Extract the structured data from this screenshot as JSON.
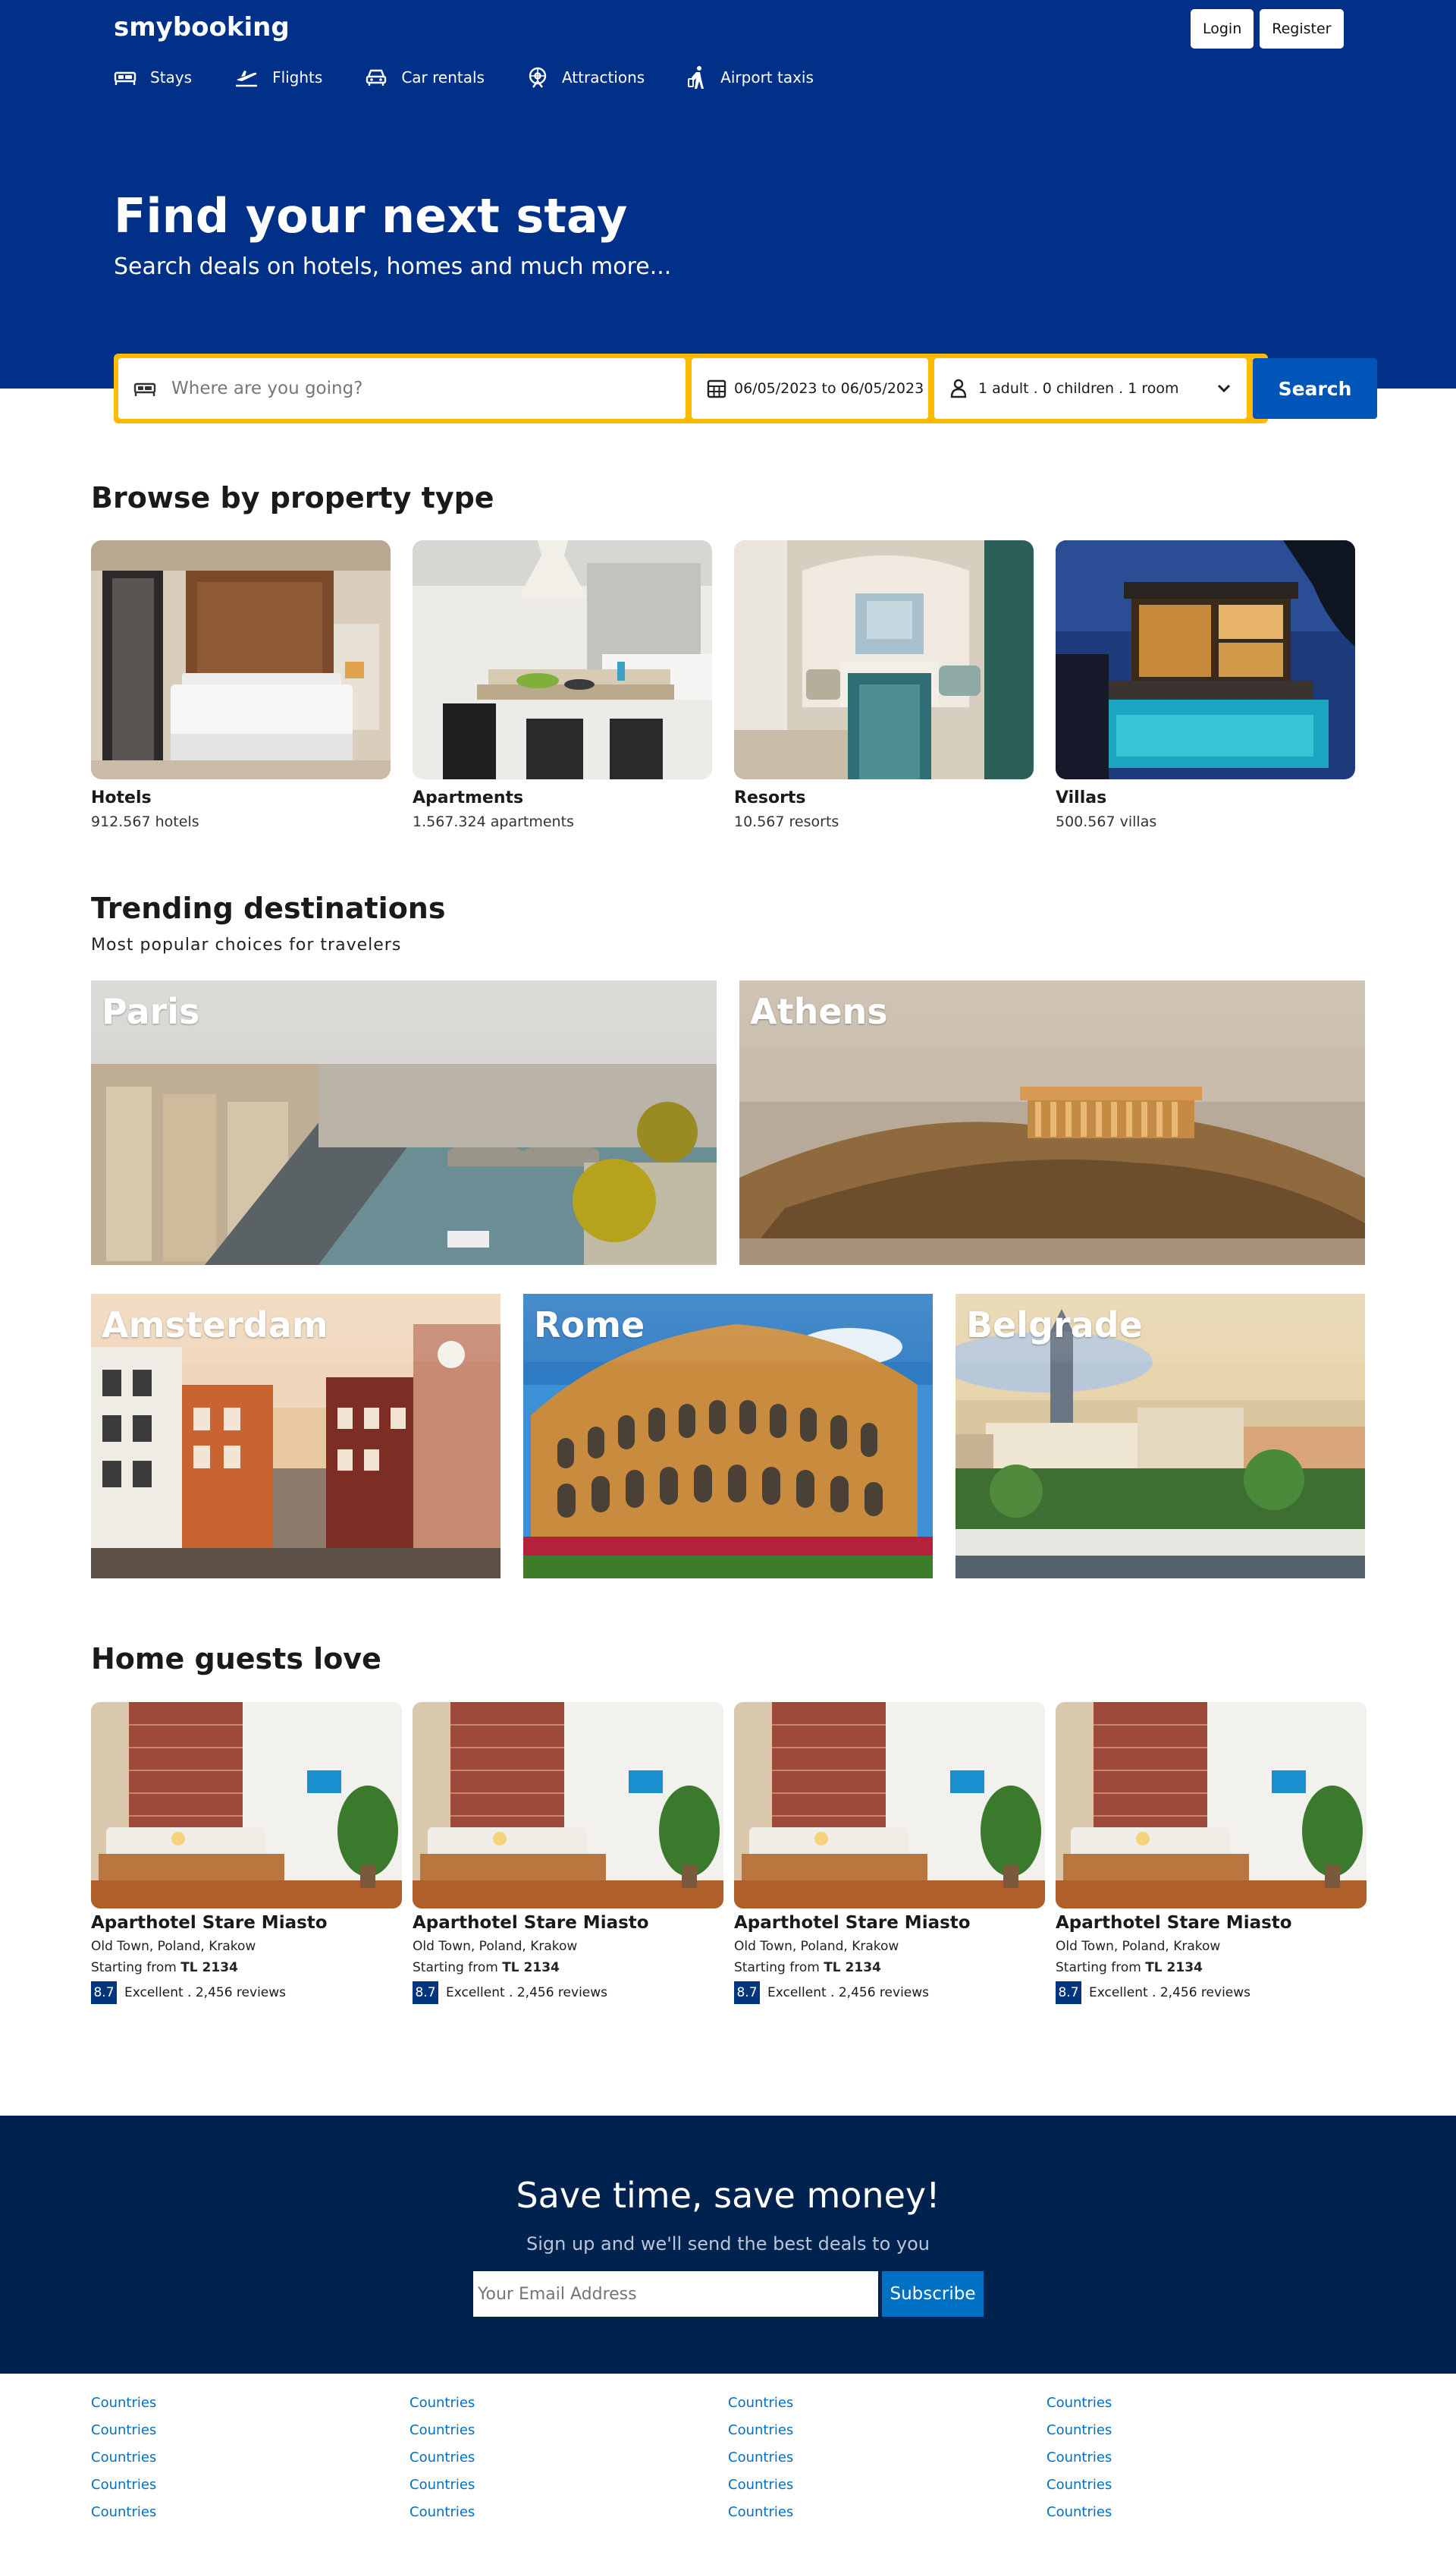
{
  "brand": {
    "name": "smybooking"
  },
  "auth": {
    "login": "Login",
    "register": "Register"
  },
  "nav": [
    {
      "label": "Stays",
      "icon": "bed-icon"
    },
    {
      "label": "Flights",
      "icon": "plane-icon"
    },
    {
      "label": "Car rentals",
      "icon": "car-icon"
    },
    {
      "label": "Attractions",
      "icon": "attractions-icon"
    },
    {
      "label": "Airport taxis",
      "icon": "taxi-icon"
    }
  ],
  "hero": {
    "title": "Find your next stay",
    "subtitle": "Search deals on hotels, homes and much more..."
  },
  "search": {
    "destination_placeholder": "Where are you going?",
    "dates": "06/05/2023 to 06/05/2023",
    "guests": "1 adult . 0 children . 1 room",
    "button": "Search"
  },
  "property_types": {
    "title": "Browse by property type",
    "items": [
      {
        "name": "Hotels",
        "count": "912.567 hotels"
      },
      {
        "name": "Apartments",
        "count": "1.567.324 apartments"
      },
      {
        "name": "Resorts",
        "count": "10.567 resorts"
      },
      {
        "name": "Villas",
        "count": "500.567 villas"
      }
    ]
  },
  "trending": {
    "title": "Trending destinations",
    "subtitle": "Most popular choices for travelers",
    "cities": [
      "Paris",
      "Athens",
      "Amsterdam",
      "Rome",
      "Belgrade"
    ]
  },
  "homes": {
    "title": "Home guests love",
    "items": [
      {
        "name": "Aparthotel Stare Miasto",
        "location": "Old Town, Poland, Krakow",
        "price_prefix": "Starting from",
        "price": "TL 2134",
        "score": "8.7",
        "rating_text": "Excellent . 2,456 reviews"
      },
      {
        "name": "Aparthotel Stare Miasto",
        "location": "Old Town, Poland, Krakow",
        "price_prefix": "Starting from",
        "price": "TL 2134",
        "score": "8.7",
        "rating_text": "Excellent . 2,456 reviews"
      },
      {
        "name": "Aparthotel Stare Miasto",
        "location": "Old Town, Poland, Krakow",
        "price_prefix": "Starting from",
        "price": "TL 2134",
        "score": "8.7",
        "rating_text": "Excellent . 2,456 reviews"
      },
      {
        "name": "Aparthotel Stare Miasto",
        "location": "Old Town, Poland, Krakow",
        "price_prefix": "Starting from",
        "price": "TL 2134",
        "score": "8.7",
        "rating_text": "Excellent . 2,456 reviews"
      }
    ]
  },
  "newsletter": {
    "title": "Save time, save money!",
    "subtitle": "Sign up and we'll send the best deals to you",
    "placeholder": "Your Email Address",
    "button": "Subscribe"
  },
  "footer": {
    "columns": [
      [
        "Countries",
        "Countries",
        "Countries",
        "Countries",
        "Countries"
      ],
      [
        "Countries",
        "Countries",
        "Countries",
        "Countries",
        "Countries"
      ],
      [
        "Countries",
        "Countries",
        "Countries",
        "Countries",
        "Countries"
      ],
      [
        "Countries",
        "Countries",
        "Countries",
        "Countries",
        "Countries"
      ]
    ]
  },
  "colors": {
    "header_bg": "#003087",
    "search_border": "#febb02",
    "search_button": "#0056b8",
    "newsletter_bg": "#00224f",
    "link": "#0071c2",
    "score_badge": "#003580"
  }
}
